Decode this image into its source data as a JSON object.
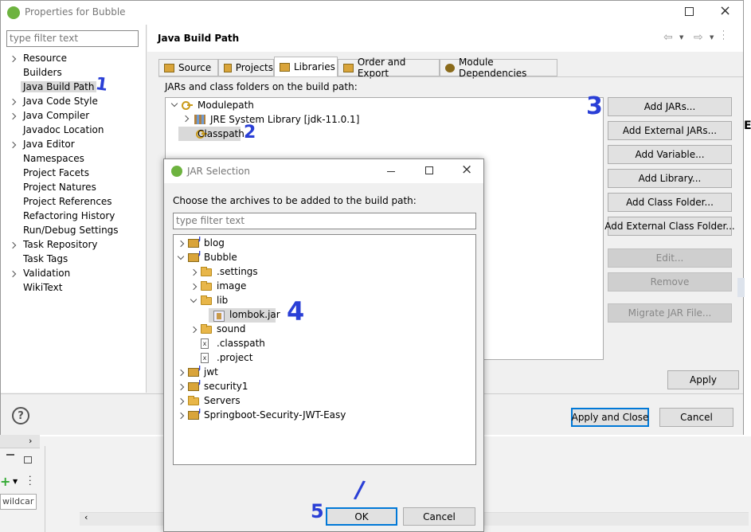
{
  "props_window": {
    "title": "Properties for Bubble",
    "filter_placeholder": "type filter text",
    "page_title": "Java Build Path",
    "nav": [
      {
        "label": "Resource",
        "expandable": true
      },
      {
        "label": "Builders",
        "expandable": false
      },
      {
        "label": "Java Build Path",
        "expandable": false,
        "selected": true
      },
      {
        "label": "Java Code Style",
        "expandable": true
      },
      {
        "label": "Java Compiler",
        "expandable": true
      },
      {
        "label": "Javadoc Location",
        "expandable": false
      },
      {
        "label": "Java Editor",
        "expandable": true
      },
      {
        "label": "Namespaces",
        "expandable": false
      },
      {
        "label": "Project Facets",
        "expandable": false
      },
      {
        "label": "Project Natures",
        "expandable": false
      },
      {
        "label": "Project References",
        "expandable": false
      },
      {
        "label": "Refactoring History",
        "expandable": false
      },
      {
        "label": "Run/Debug Settings",
        "expandable": false
      },
      {
        "label": "Task Repository",
        "expandable": true
      },
      {
        "label": "Task Tags",
        "expandable": false
      },
      {
        "label": "Validation",
        "expandable": true
      },
      {
        "label": "WikiText",
        "expandable": false
      }
    ],
    "tabs": [
      "Source",
      "Projects",
      "Libraries",
      "Order and Export",
      "Module Dependencies"
    ],
    "build_path_label": "JARs and class folders on the build path:",
    "tree": {
      "modulepath": "Modulepath",
      "jre": "JRE System Library [jdk-11.0.1]",
      "classpath": "Classpath"
    },
    "side_buttons": [
      "Add JARs...",
      "Add External JARs...",
      "Add Variable...",
      "Add Library...",
      "Add Class Folder...",
      "Add External Class Folder...",
      "Edit...",
      "Remove",
      "Migrate JAR File..."
    ],
    "apply": "Apply",
    "apply_close": "Apply and Close",
    "cancel": "Cancel",
    "help_glyph": "?"
  },
  "jar_dialog": {
    "title": "JAR Selection",
    "prompt": "Choose the archives to be added to the build path:",
    "filter_placeholder": "type filter text",
    "items": {
      "blog": "blog",
      "bubble": "Bubble",
      "settings": ".settings",
      "image": "image",
      "lib": "lib",
      "lombok": "lombok.jar",
      "sound": "sound",
      "classpath": ".classpath",
      "project": ".project",
      "jwt": "jwt",
      "security1": "security1",
      "servers": "Servers",
      "springboot": "Springboot-Security-JWT-Easy"
    },
    "ok": "OK",
    "cancel": "Cancel"
  },
  "background": {
    "search_fragment": "wildcar"
  },
  "annotations": [
    "1",
    "2",
    "3",
    "4",
    "5",
    "/"
  ],
  "colors": {
    "selection": "#d9d9d9",
    "default_button_border": "#0078d7",
    "annotation": "#2a3fd6"
  }
}
